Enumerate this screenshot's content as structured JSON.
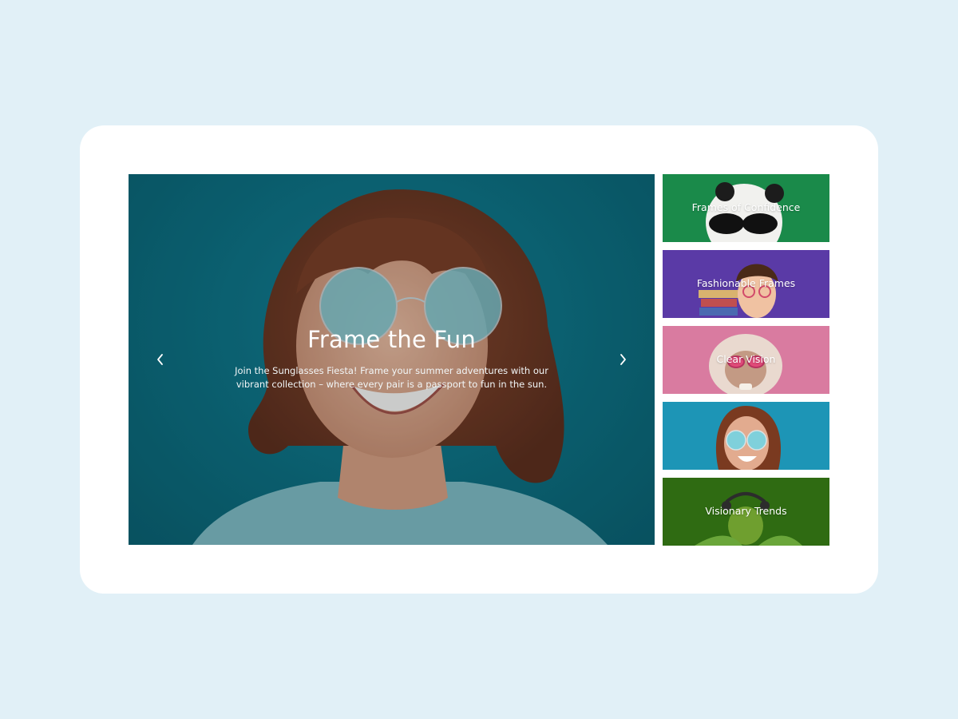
{
  "hero": {
    "title": "Frame the Fun",
    "description": "Join the Sunglasses Fiesta! Frame your summer adventures with our vibrant collection – where every pair is a passport to fun in the sun.",
    "prev_icon": "chevron-left-icon",
    "next_icon": "chevron-right-icon"
  },
  "thumbnails": [
    {
      "label": "Frames of Confidence",
      "color": "#1a8a4a"
    },
    {
      "label": "Fashionable Frames",
      "color": "#5a3aa6"
    },
    {
      "label": "Clear Vision",
      "color": "#d97ba0"
    },
    {
      "label": "",
      "color": "#1d95b6"
    },
    {
      "label": "Visionary Trends",
      "color": "#2f6b12"
    }
  ],
  "colors": {
    "page_background": "#e1f0f7",
    "card_background": "#ffffff",
    "hero_background": "#0e6f80"
  }
}
